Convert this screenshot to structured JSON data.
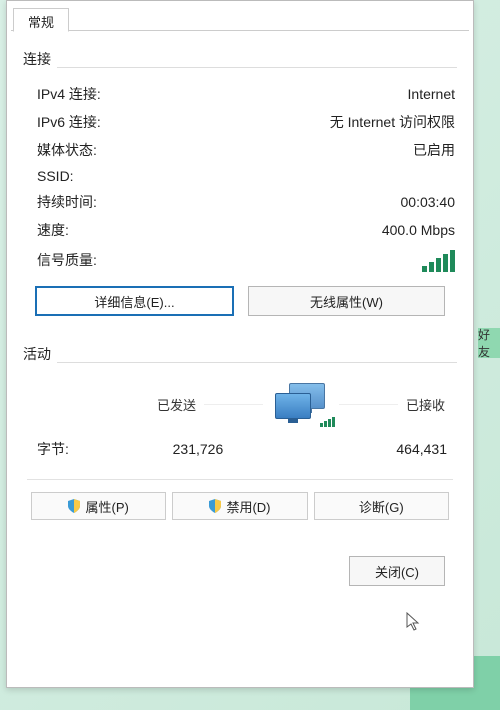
{
  "tab": {
    "general": "常规"
  },
  "connection": {
    "group_label": "连接",
    "ipv4_label": "IPv4 连接:",
    "ipv4_value": "Internet",
    "ipv6_label": "IPv6 连接:",
    "ipv6_value": "无 Internet 访问权限",
    "media_label": "媒体状态:",
    "media_value": "已启用",
    "ssid_label": "SSID:",
    "duration_label": "持续时间:",
    "duration_value": "00:03:40",
    "speed_label": "速度:",
    "speed_value": "400.0 Mbps",
    "signal_label": "信号质量:"
  },
  "buttons": {
    "details": "详细信息(E)...",
    "wireless_props": "无线属性(W)"
  },
  "activity": {
    "group_label": "活动",
    "sent_label": "已发送",
    "recv_label": "已接收",
    "bytes_label": "字节:",
    "bytes_sent": "231,726",
    "bytes_recv": "464,431"
  },
  "actions": {
    "properties": "属性(P)",
    "disable": "禁用(D)",
    "diagnose": "诊断(G)"
  },
  "footer": {
    "close": "关闭(C)"
  },
  "side_text": "好友"
}
